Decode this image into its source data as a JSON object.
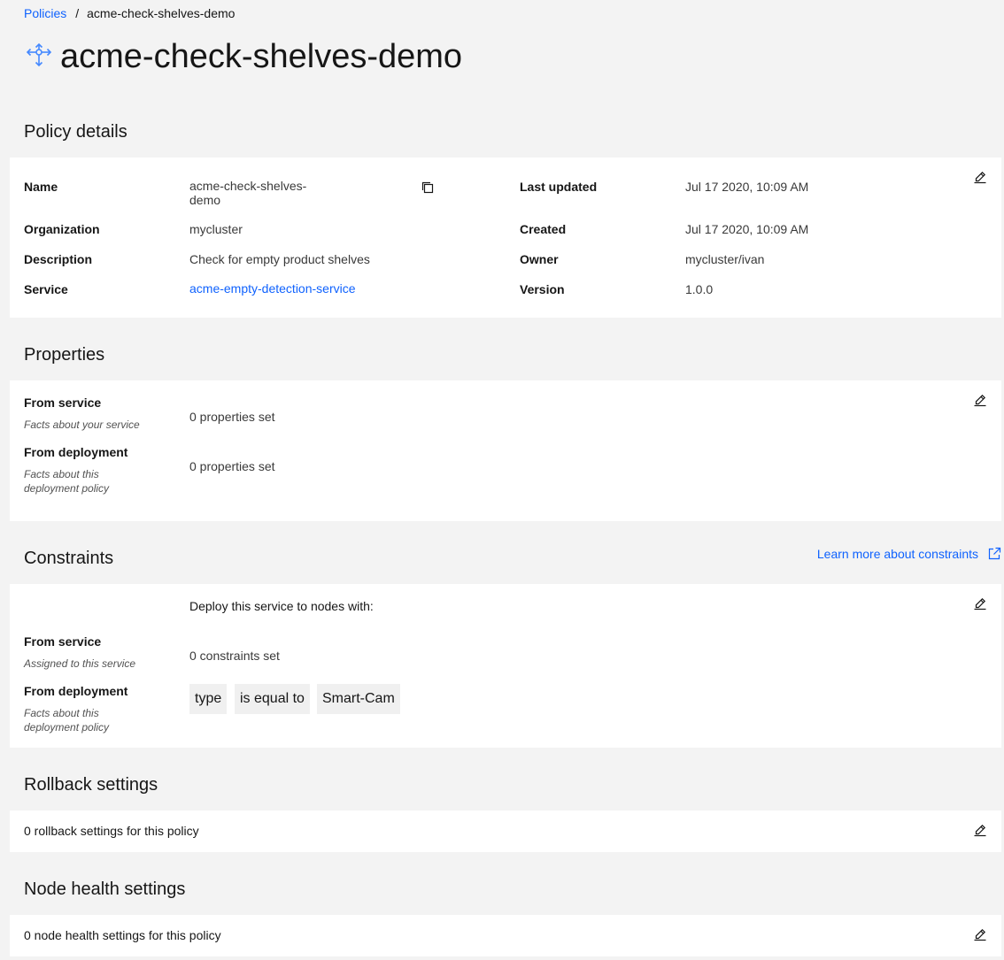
{
  "breadcrumb": {
    "parent": "Policies",
    "separator": "/",
    "current": "acme-check-shelves-demo"
  },
  "page": {
    "title": "acme-check-shelves-demo",
    "icon": "deployment-policy-icon"
  },
  "policy_details": {
    "heading": "Policy details",
    "name_label": "Name",
    "name_value_line1": "acme-check-shelves-",
    "name_value_line2": "demo",
    "organization_label": "Organization",
    "organization_value": "mycluster",
    "description_label": "Description",
    "description_value": "Check for empty product shelves",
    "service_label": "Service",
    "service_value": "acme-empty-detection-service",
    "last_updated_label": "Last updated",
    "last_updated_value": "Jul 17 2020, 10:09 AM",
    "created_label": "Created",
    "created_value": "Jul 17 2020, 10:09 AM",
    "owner_label": "Owner",
    "owner_value": "mycluster/ivan",
    "version_label": "Version",
    "version_value": "1.0.0"
  },
  "properties": {
    "heading": "Properties",
    "from_service_label": "From service",
    "from_service_sub": "Facts about your service",
    "from_service_value": "0 properties set",
    "from_deployment_label": "From deployment",
    "from_deployment_sub_line1": "Facts about this",
    "from_deployment_sub_line2": "deployment policy",
    "from_deployment_value": "0 properties set"
  },
  "constraints": {
    "heading": "Constraints",
    "learn_more": "Learn more about constraints",
    "intro": "Deploy this service to nodes with:",
    "from_service_label": "From service",
    "from_service_sub": "Assigned to this service",
    "from_service_value": "0 constraints set",
    "from_deployment_label": "From deployment",
    "from_deployment_sub_line1": "Facts about this",
    "from_deployment_sub_line2": "deployment policy",
    "tags": [
      "type",
      "is equal to",
      "Smart-Cam"
    ]
  },
  "rollback": {
    "heading": "Rollback settings",
    "value": "0 rollback settings for this policy"
  },
  "node_health": {
    "heading": "Node health settings",
    "value": "0 node health settings for this policy"
  },
  "colors": {
    "background": "#f3f3f3",
    "card": "#ffffff",
    "link": "#0f62fe",
    "tag": "#f0f0f0",
    "icon_blue": "#4589ff"
  }
}
